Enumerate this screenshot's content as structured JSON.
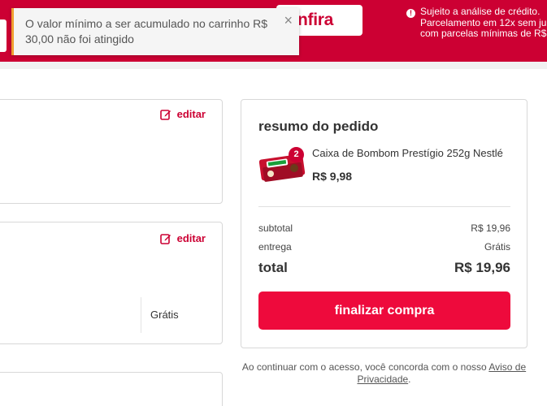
{
  "header": {
    "confira_label": "nfira",
    "credit_notice": {
      "line1": "Sujeito a análise de crédito.",
      "line2": "Parcelamento em 12x sem ju",
      "line3": "com parcelas mínimas de R$"
    },
    "brand_color": "#cc0033"
  },
  "toast": {
    "message": "O valor mínimo a ser acumulado no carrinho R$ 30,00 não foi atingido",
    "close_glyph": "×",
    "accent_color": "#f0a030"
  },
  "cards": {
    "edit_label": "editar",
    "shipping_price": "Grátis"
  },
  "summary": {
    "title": "resumo do pedido",
    "product": {
      "name": "Caixa de Bombom Prestígio 252g Nestlé",
      "quantity": "2",
      "price": "R$ 9,98",
      "image_icon": "chocolate-box-image"
    },
    "subtotal_label": "subtotal",
    "subtotal_value": "R$ 19,96",
    "delivery_label": "entrega",
    "delivery_value": "Grátis",
    "total_label": "total",
    "total_value": "R$ 19,96",
    "checkout_label": "finalizar compra",
    "checkout_color": "#ee0a3c"
  },
  "privacy": {
    "text_before": "Ao continuar com o acesso, você concorda com o nosso ",
    "link_label": "Aviso de Privacidade",
    "text_after": "."
  }
}
